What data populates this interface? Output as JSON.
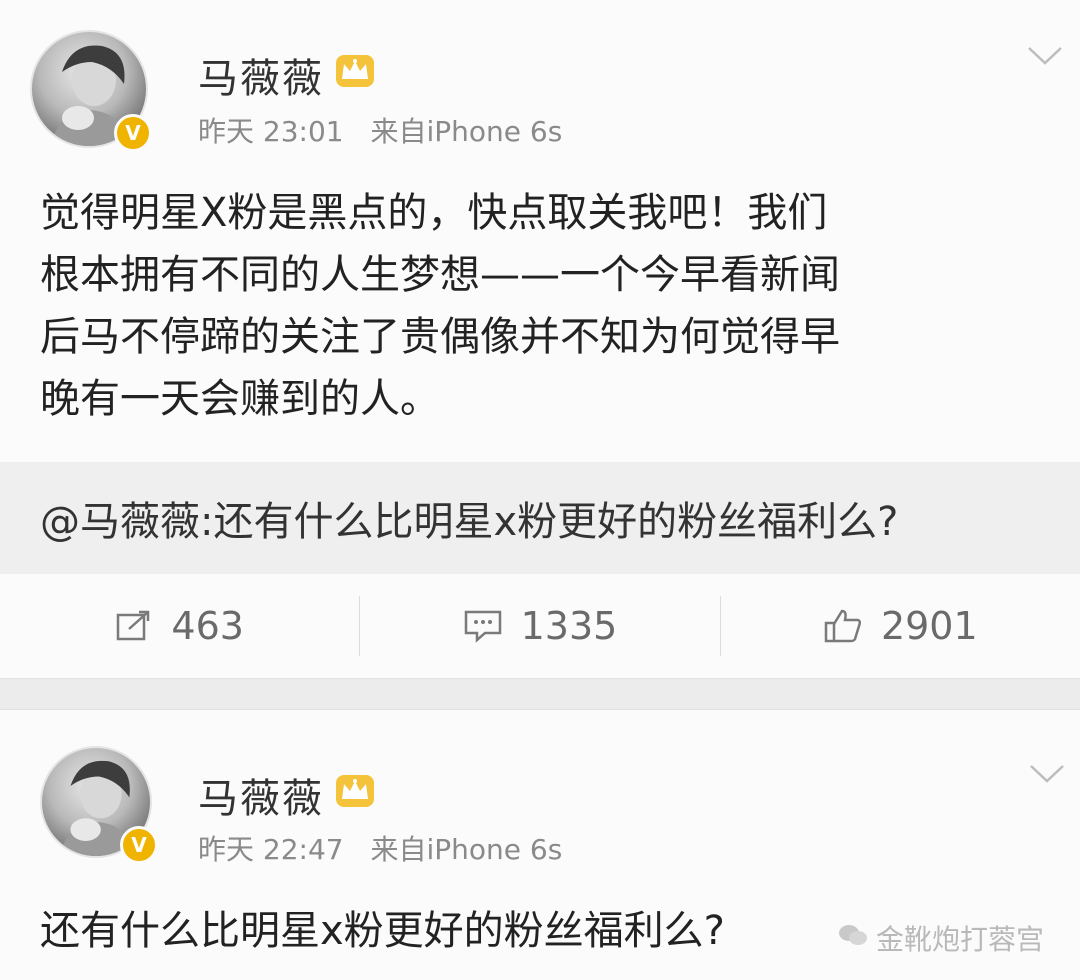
{
  "post1": {
    "username": "马薇薇",
    "time": "昨天 23:01",
    "source": "来自iPhone 6s",
    "lines": [
      "觉得明星X粉是黑点的，快点取关我吧！我们",
      "根本拥有不同的人生梦想——一个今早看新闻",
      "后马不停蹄的关注了贵偶像并不知为何觉得早",
      "晚有一天会赚到的人。"
    ],
    "repost_text": "@马薇薇:还有什么比明星x粉更好的粉丝福利么?",
    "actions": {
      "repost_count": "463",
      "comment_count": "1335",
      "like_count": "2901"
    }
  },
  "post2": {
    "username": "马薇薇",
    "time": "昨天 22:47",
    "source": "来自iPhone 6s",
    "text": "还有什么比明星x粉更好的粉丝福利么?"
  },
  "watermark": {
    "text": "金靴炮打蓉宫"
  },
  "icons": {
    "verified": "verified-badge-icon",
    "crown": "crown-icon",
    "chevron": "chevron-down-icon",
    "repost": "repost-icon",
    "comment": "comment-icon",
    "like": "thumbs-up-icon"
  },
  "colors": {
    "verified": "#f0b400",
    "meta": "#8a8a8a",
    "repost_bg": "#efefef"
  }
}
